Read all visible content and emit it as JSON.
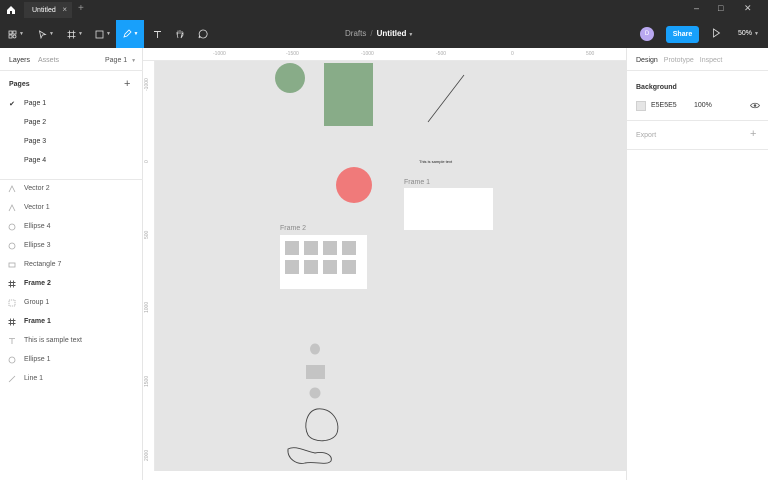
{
  "titlebar": {
    "tab_title": "Untitled",
    "close_glyph": "×",
    "newtab_glyph": "+",
    "minimize_glyph": "–",
    "maximize_glyph": "□",
    "window_close_glyph": "✕"
  },
  "toolbar": {
    "breadcrumb_project": "Drafts",
    "breadcrumb_sep": "/",
    "file_name": "Untitled",
    "avatar_initial": "D",
    "share_label": "Share",
    "zoom_label": "50%",
    "pen_tool_active": true,
    "tools": [
      "main-menu-icon",
      "move-icon",
      "frame-icon",
      "shape-icon",
      "pen-icon",
      "text-icon",
      "hand-icon",
      "comment-icon"
    ]
  },
  "left_panel": {
    "tabs": [
      "Layers",
      "Assets"
    ],
    "page_selector": "Page 1",
    "pages_title": "Pages",
    "pages": [
      {
        "label": "Page 1",
        "current": true
      },
      {
        "label": "Page 2",
        "current": false
      },
      {
        "label": "Page 3",
        "current": false
      },
      {
        "label": "Page 4",
        "current": false
      }
    ],
    "layers": [
      {
        "label": "Vector 2",
        "icon": "vector-icon",
        "bold": false
      },
      {
        "label": "Vector 1",
        "icon": "vector-icon",
        "bold": false
      },
      {
        "label": "Ellipse 4",
        "icon": "ellipse-icon",
        "bold": false
      },
      {
        "label": "Ellipse 3",
        "icon": "ellipse-icon",
        "bold": false
      },
      {
        "label": "Rectangle 7",
        "icon": "rectangle-icon",
        "bold": false
      },
      {
        "label": "Frame 2",
        "icon": "frame-icon",
        "bold": true
      },
      {
        "label": "Group 1",
        "icon": "group-icon",
        "bold": false
      },
      {
        "label": "Frame 1",
        "icon": "frame-icon",
        "bold": true
      },
      {
        "label": "This is sample text",
        "icon": "text-icon",
        "bold": false
      },
      {
        "label": "Ellipse 1",
        "icon": "ellipse-icon",
        "bold": false
      },
      {
        "label": "Line 1",
        "icon": "line-icon",
        "bold": false
      }
    ]
  },
  "rulers": {
    "horizontal": [
      "-1000",
      "-1500",
      "-1000",
      "-500",
      "0",
      "500"
    ],
    "vertical": [
      "-1000",
      "0",
      "500",
      "1000",
      "1500",
      "2000"
    ]
  },
  "canvas": {
    "background": "#e5e5e5",
    "sample_text": "This is sample text",
    "frame1_label": "Frame 1",
    "frame2_label": "Frame 2",
    "colors": {
      "green": "#88ac88",
      "red": "#f07a7a",
      "gray": "#c4c4c4"
    }
  },
  "right_panel": {
    "tabs": [
      "Design",
      "Prototype",
      "Inspect"
    ],
    "background_title": "Background",
    "background_hex": "E5E5E5",
    "background_opacity": "100%",
    "export_label": "Export"
  }
}
